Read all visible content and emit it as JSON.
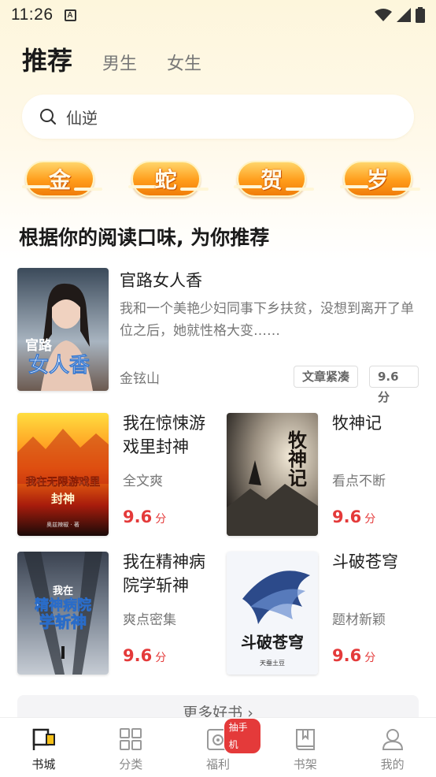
{
  "status_bar": {
    "time": "11:26",
    "a_icon": "A"
  },
  "tabs": {
    "active": "推荐",
    "items": [
      "男生",
      "女生"
    ]
  },
  "search": {
    "value": "仙逆"
  },
  "badges": [
    "金",
    "蛇",
    "贺",
    "岁"
  ],
  "section_title": "根据你的阅读口味, 为你推荐",
  "featured": {
    "title": "官路女人香",
    "description": "我和一个美艳少妇同事下乡扶贫，没想到离开了单位之后，她就性格大变……",
    "author": "金铉山",
    "tags": [
      "文章紧凑",
      "9.6分"
    ],
    "cover_text": [
      "官路",
      "女人香"
    ]
  },
  "grid": [
    {
      "title": "我在惊悚游戏里封神",
      "subtitle": "全文爽",
      "score": "9.6",
      "unit": "分",
      "cover_text": [
        "我在无限游戏里",
        "封神"
      ],
      "cover_author": "奥兹辣椒 · 著"
    },
    {
      "title": "牧神记",
      "subtitle": "看点不断",
      "score": "9.6",
      "unit": "分",
      "cover_text": [
        "牧神记"
      ]
    },
    {
      "title": "我在精神病院学斩神",
      "subtitle": "爽点密集",
      "score": "9.6",
      "unit": "分",
      "cover_text": [
        "我在",
        "精神病院",
        "学斩神"
      ]
    },
    {
      "title": "斗破苍穹",
      "subtitle": "题材新颖",
      "score": "9.6",
      "unit": "分",
      "cover_text": [
        "斗破苍穹",
        "天蚕土豆"
      ]
    }
  ],
  "more": "更多好书",
  "bottom_nav": [
    {
      "label": "书城",
      "icon": "flag-icon",
      "active": true
    },
    {
      "label": "分类",
      "icon": "grid-icon",
      "active": false
    },
    {
      "label": "福利",
      "icon": "camera-icon",
      "active": false,
      "badge": "抽手机"
    },
    {
      "label": "书架",
      "icon": "book-icon",
      "active": false
    },
    {
      "label": "我的",
      "icon": "person-icon",
      "active": false
    }
  ],
  "colors": {
    "accent_red": "#e43a3a",
    "badge_orange": "#ff9c1a",
    "top_bg": "#fdf6dc"
  }
}
